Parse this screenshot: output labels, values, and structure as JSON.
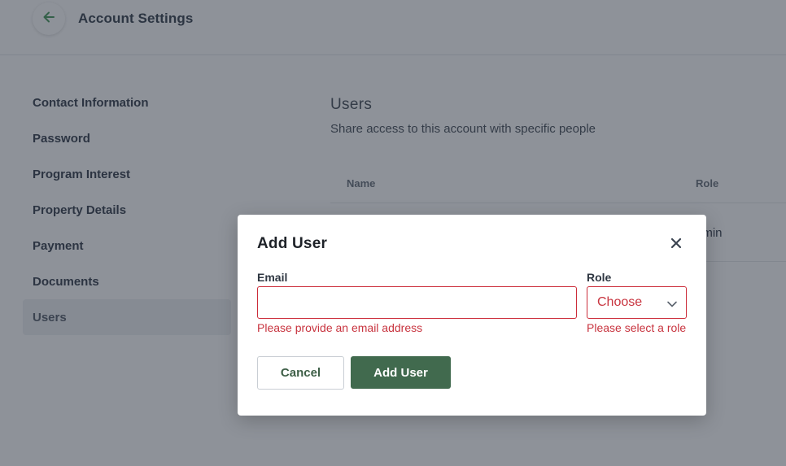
{
  "header": {
    "title": "Account Settings",
    "back_icon": "arrow-left-icon",
    "back_icon_color": "#4a9a5f"
  },
  "sidebar": {
    "items": [
      {
        "label": "Contact Information",
        "active": false
      },
      {
        "label": "Password",
        "active": false
      },
      {
        "label": "Program Interest",
        "active": false
      },
      {
        "label": "Property Details",
        "active": false
      },
      {
        "label": "Payment",
        "active": false
      },
      {
        "label": "Documents",
        "active": false
      },
      {
        "label": "Users",
        "active": true
      }
    ]
  },
  "main": {
    "section_title": "Users",
    "section_subtitle": "Share access to this account with specific people",
    "table": {
      "columns": [
        "Name",
        "Role"
      ],
      "rows": [
        {
          "role": "dmin"
        }
      ]
    }
  },
  "modal": {
    "title": "Add User",
    "close_icon": "close-icon",
    "email": {
      "label": "Email",
      "value": "",
      "placeholder": "",
      "error": "Please provide an email address"
    },
    "role": {
      "label": "Role",
      "selected": "Choose",
      "error": "Please select a role"
    },
    "cancel_label": "Cancel",
    "submit_label": "Add User"
  },
  "colors": {
    "primary": "#416a4e",
    "error": "#c8343f",
    "overlay": "rgba(30, 38, 52, 0.50)"
  }
}
